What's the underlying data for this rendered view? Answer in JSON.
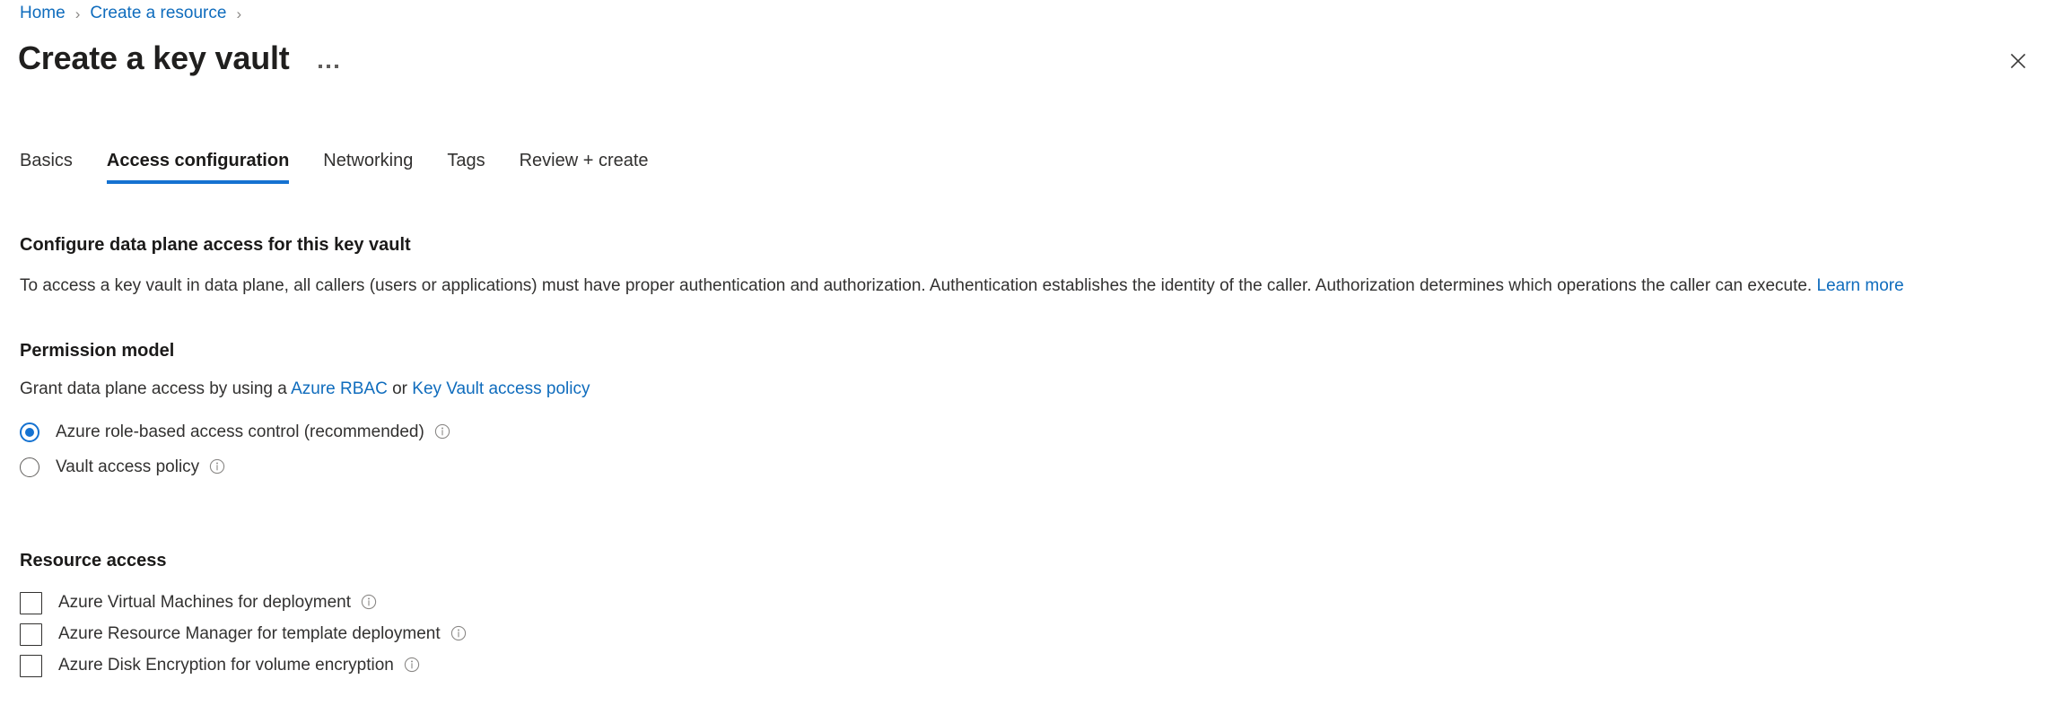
{
  "breadcrumb": {
    "items": [
      {
        "label": "Home"
      },
      {
        "label": "Create a resource"
      }
    ],
    "separator": "›"
  },
  "header": {
    "title": "Create a key vault",
    "more_menu_icon": "ellipsis-icon",
    "close_icon": "close-icon"
  },
  "tabs": [
    {
      "label": "Basics",
      "active": false
    },
    {
      "label": "Access configuration",
      "active": true
    },
    {
      "label": "Networking",
      "active": false
    },
    {
      "label": "Tags",
      "active": false
    },
    {
      "label": "Review + create",
      "active": false
    }
  ],
  "main": {
    "data_plane": {
      "heading": "Configure data plane access for this key vault",
      "description": "To access a key vault in data plane, all callers (users or applications) must have proper authentication and authorization. Authentication establishes the identity of the caller. Authorization determines which operations the caller can execute.",
      "learn_more_label": "Learn more"
    },
    "permission_model": {
      "heading": "Permission model",
      "sub_prefix": "Grant data plane access by using a",
      "link_rbac": "Azure RBAC",
      "sub_middle": "or",
      "link_policy": "Key Vault access policy",
      "options": [
        {
          "label": "Azure role-based access control (recommended)",
          "selected": true,
          "info_icon": "info-icon"
        },
        {
          "label": "Vault access policy",
          "selected": false,
          "info_icon": "info-icon"
        }
      ]
    },
    "resource_access": {
      "heading": "Resource access",
      "options": [
        {
          "label": "Azure Virtual Machines for deployment",
          "checked": false,
          "info_icon": "info-icon"
        },
        {
          "label": "Azure Resource Manager for template deployment",
          "checked": false,
          "info_icon": "info-icon"
        },
        {
          "label": "Azure Disk Encryption for volume encryption",
          "checked": false,
          "info_icon": "info-icon"
        }
      ]
    }
  },
  "colors": {
    "link": "#0f6cbd",
    "accent": "#1572d1",
    "text": "#323130",
    "heading": "#1b1a19"
  }
}
